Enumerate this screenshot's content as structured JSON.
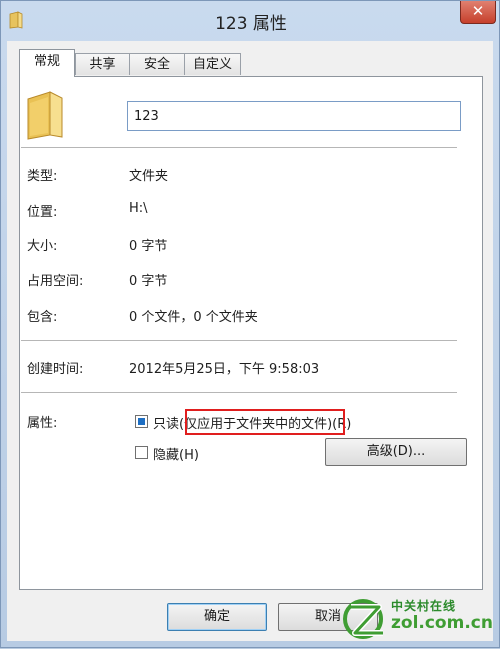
{
  "window": {
    "title": "123 属性",
    "close_glyph": "✕"
  },
  "tabs": [
    {
      "label": "常规",
      "active": true
    },
    {
      "label": "共享",
      "active": false
    },
    {
      "label": "安全",
      "active": false
    },
    {
      "label": "自定义",
      "active": false
    }
  ],
  "general": {
    "name_value": "123",
    "type_label": "类型:",
    "type_value": "文件夹",
    "location_label": "位置:",
    "location_value": "H:\\",
    "size_label": "大小:",
    "size_value": "0 字节",
    "size_on_disk_label": "占用空间:",
    "size_on_disk_value": "0 字节",
    "contains_label": "包含:",
    "contains_value": "0 个文件，0 个文件夹",
    "created_label": "创建时间:",
    "created_value": "2012年5月25日，下午 9:58:03",
    "attributes_label": "属性:",
    "readonly_label": "只读(仅应用于文件夹中的文件)(R)",
    "readonly_state": "indeterminate",
    "hidden_label": "隐藏(H)",
    "hidden_checked": false,
    "advanced_button": "高级(D)..."
  },
  "buttons": {
    "ok": "确定",
    "cancel": "取消"
  },
  "watermark": {
    "brand_cn": "中关村在线",
    "brand_url": "zol.com.cn"
  },
  "icons": {
    "title_icon": "folder-icon",
    "main_icon": "folder-icon",
    "close": "close-icon"
  },
  "colors": {
    "highlight": "#e01e1e",
    "folder": "#f2d27a",
    "watermark_green": "#3f9d33"
  }
}
